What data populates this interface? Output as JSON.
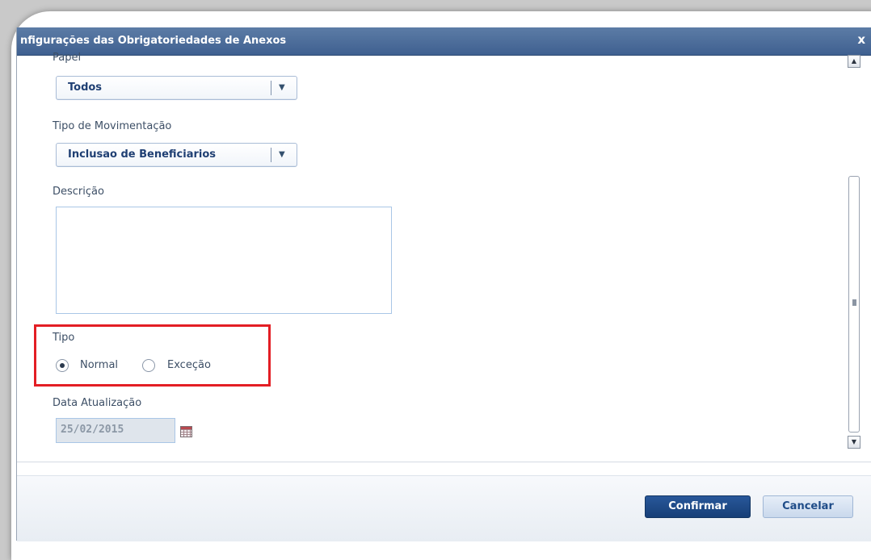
{
  "dialog": {
    "title": "nfigurações das Obrigatoriedades de Anexos",
    "close_label": "x"
  },
  "form": {
    "papel": {
      "label": "Papel",
      "value": "Todos"
    },
    "tipo_movimentacao": {
      "label": "Tipo de Movimentação",
      "value": "Inclusao de Beneficiarios"
    },
    "descricao": {
      "label": "Descrição",
      "value": ""
    },
    "tipo": {
      "label": "Tipo",
      "options": [
        {
          "label": "Normal",
          "selected": true
        },
        {
          "label": "Exceção",
          "selected": false
        }
      ]
    },
    "data_atualizacao": {
      "label": "Data Atualização",
      "value": "25/02/2015"
    }
  },
  "footer": {
    "confirm_label": "Confirmar",
    "cancel_label": "Cancelar"
  },
  "colors": {
    "titlebar": "#4a6a98",
    "highlight": "#e31e24",
    "primary_button": "#1f4a86"
  },
  "icons": {
    "close": "close-icon",
    "dropdown": "chevron-down-icon",
    "calendar": "calendar-icon",
    "scroll_up": "scroll-up-arrow-icon",
    "scroll_down": "scroll-down-arrow-icon"
  }
}
